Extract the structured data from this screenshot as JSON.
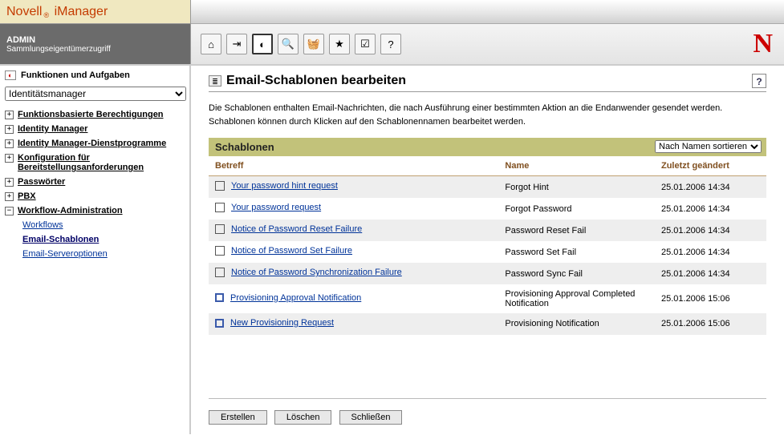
{
  "brand": {
    "name": "Novell",
    "product": "iManager",
    "reg": "®"
  },
  "header": {
    "user": "ADMIN",
    "access": "Sammlungseigentümerzugriff"
  },
  "toolbar_icons": [
    "⌂",
    "⇥",
    "◐",
    "🔍",
    "🧺",
    "★",
    "☑",
    "?"
  ],
  "big_n": "N",
  "sidebar": {
    "title": "Funktionen und Aufgaben",
    "dropdown": "Identitätsmanager",
    "items": [
      {
        "label": "Funktionsbasierte Berechtigungen",
        "expanded": false
      },
      {
        "label": "Identity Manager",
        "expanded": false
      },
      {
        "label": "Identity Manager-Dienstprogramme",
        "expanded": false
      },
      {
        "label": "Konfiguration für Bereitstellungsanforderungen",
        "expanded": false
      },
      {
        "label": "Passwörter",
        "expanded": false
      },
      {
        "label": "PBX",
        "expanded": false
      },
      {
        "label": "Workflow-Administration",
        "expanded": true,
        "children": [
          {
            "label": "Workflows",
            "active": false
          },
          {
            "label": "Email-Schablonen",
            "active": true
          },
          {
            "label": "Email-Serveroptionen",
            "active": false
          }
        ]
      }
    ]
  },
  "page": {
    "title": "Email-Schablonen bearbeiten",
    "intro": "Die Schablonen enthalten Email-Nachrichten, die nach Ausführung einer bestimmten Aktion an die Endanwender gesendet werden. Schablonen können durch Klicken auf den Schablonennamen bearbeitet werden.",
    "section": "Schablonen",
    "sort": "Nach Namen sortieren",
    "columns": {
      "subject": "Betreff",
      "name": "Name",
      "changed": "Zuletzt geändert"
    },
    "rows": [
      {
        "subject": "Your password hint request",
        "name": "Forgot Hint",
        "changed": "25.01.2006 14:34",
        "new": false
      },
      {
        "subject": "Your password request",
        "name": "Forgot Password",
        "changed": "25.01.2006 14:34",
        "new": false
      },
      {
        "subject": "Notice of Password Reset Failure",
        "name": "Password Reset Fail",
        "changed": "25.01.2006 14:34",
        "new": false
      },
      {
        "subject": "Notice of Password Set Failure",
        "name": "Password Set Fail",
        "changed": "25.01.2006 14:34",
        "new": false
      },
      {
        "subject": "Notice of Password Synchronization Failure",
        "name": "Password Sync Fail",
        "changed": "25.01.2006 14:34",
        "new": false
      },
      {
        "subject": "Provisioning Approval Notification",
        "name": "Provisioning Approval Completed Notification",
        "changed": "25.01.2006 15:06",
        "new": true
      },
      {
        "subject": "New Provisioning Request",
        "name": "Provisioning Notification",
        "changed": "25.01.2006 15:06",
        "new": true
      }
    ],
    "actions": {
      "create": "Erstellen",
      "delete": "Löschen",
      "close": "Schließen"
    },
    "help": "?"
  }
}
